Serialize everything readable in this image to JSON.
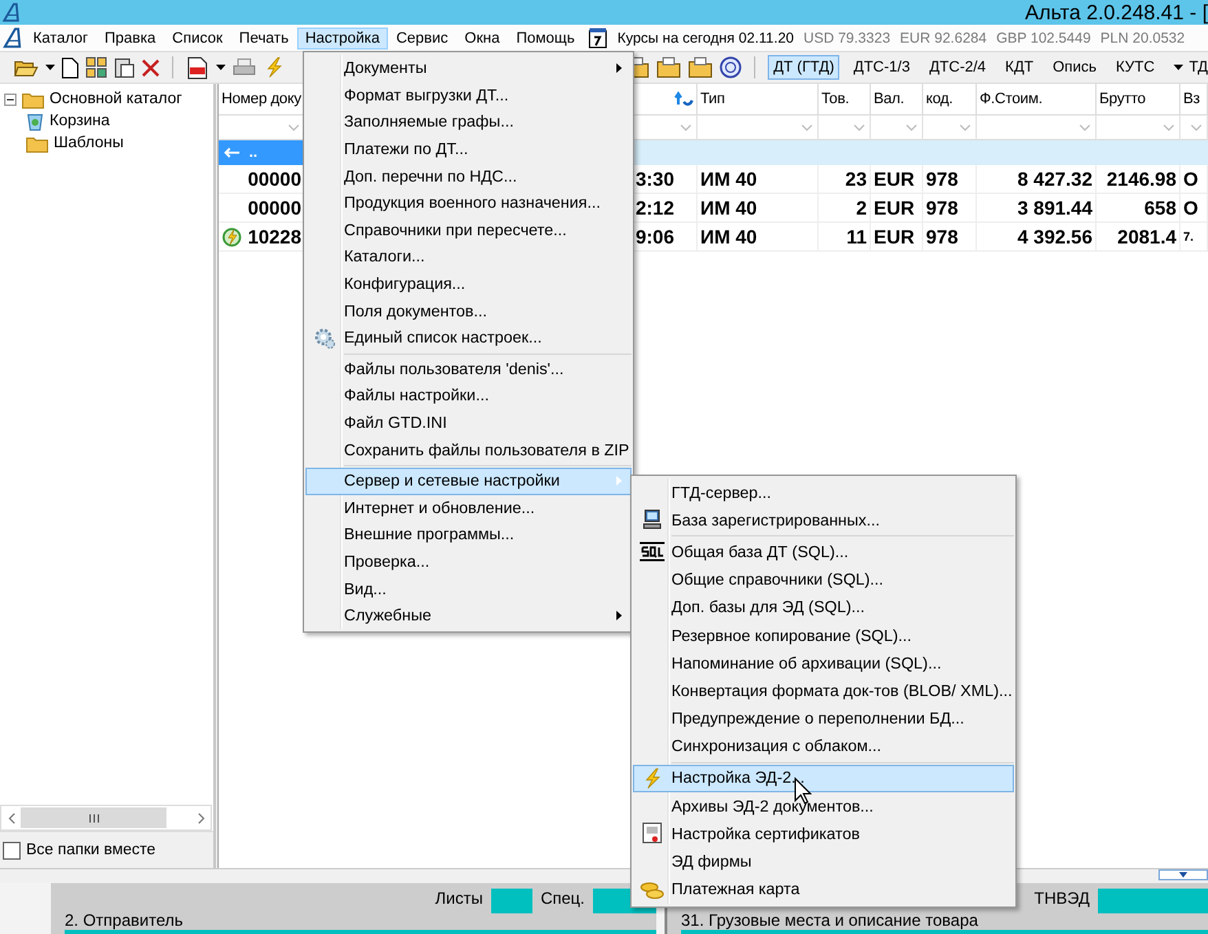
{
  "window": {
    "title": "Альта 2.0.248.41 - ["
  },
  "menu_bar": {
    "items": [
      {
        "label": "Каталог",
        "selected": false
      },
      {
        "label": "Правка",
        "selected": false
      },
      {
        "label": "Список",
        "selected": false
      },
      {
        "label": "Печать",
        "selected": false
      },
      {
        "label": "Настройка",
        "selected": true
      },
      {
        "label": "Сервис",
        "selected": false
      },
      {
        "label": "Окна",
        "selected": false
      },
      {
        "label": "Помощь",
        "selected": false
      }
    ]
  },
  "rates": {
    "label": "Курсы на сегодня 02.11.20",
    "values": [
      "USD 79.3323",
      "EUR 92.6284",
      "GBP 102.5449",
      "PLN 20.0532"
    ]
  },
  "toolbar": {
    "doc_buttons": [
      {
        "label": "ДТ (ГТД)",
        "selected": true
      },
      {
        "label": "ДТС-1/3",
        "selected": false
      },
      {
        "label": "ДТС-2/4",
        "selected": false
      },
      {
        "label": "КДТ",
        "selected": false
      },
      {
        "label": "Опись",
        "selected": false
      },
      {
        "label": "КУТС",
        "selected": false
      }
    ],
    "dropdown": "ТД"
  },
  "sidebar": {
    "tree": [
      {
        "label": "Основной каталог",
        "kind": "folder",
        "expanded": true,
        "children": [
          {
            "label": "Корзина",
            "kind": "trash"
          },
          {
            "label": "Шаблоны",
            "kind": "folder"
          }
        ]
      }
    ],
    "all_folders": {
      "label": "Все папки вместе",
      "checked": false
    }
  },
  "table": {
    "columns": [
      {
        "label": "Номер доку",
        "sorted": false
      },
      {
        "sorted": true
      },
      {
        "label": "Тип",
        "sorted": false
      },
      {
        "label": "Тов.",
        "sorted": false
      },
      {
        "label": "Вал.",
        "sorted": false
      },
      {
        "label": "код.",
        "sorted": false
      },
      {
        "label": "Ф.Стоим.",
        "sorted": false
      },
      {
        "label": "Брутто",
        "sorted": false
      },
      {
        "label": "Вз",
        "sorted": false
      }
    ],
    "parent_row": {
      "label": ".."
    },
    "rows": [
      {
        "status_icon": false,
        "cells": [
          "00000",
          "3:30",
          "ИМ 40",
          "23",
          "EUR",
          "978",
          "8 427.32",
          "2146.98",
          "О"
        ]
      },
      {
        "status_icon": false,
        "cells": [
          "00000",
          "2:12",
          "ИМ 40",
          "2",
          "EUR",
          "978",
          "3 891.44",
          "658",
          "О"
        ]
      },
      {
        "status_icon": true,
        "cells": [
          "10228",
          "9:06",
          "ИМ 40",
          "11",
          "EUR",
          "978",
          "4 392.56",
          "2081.4",
          "7."
        ]
      }
    ]
  },
  "form": {
    "sender": "2. Отправитель",
    "sheets": "Листы",
    "spec": "Спец.",
    "goods": "31. Грузовые места и описание товара",
    "hs_code": "ТНВЭД"
  },
  "menu": {
    "items": [
      {
        "kind": "item",
        "label": "Документы",
        "has_submenu": true,
        "selected": false
      },
      {
        "kind": "item",
        "label": "Формат выгрузки ДТ...",
        "has_submenu": false,
        "selected": false
      },
      {
        "kind": "item",
        "label": "Заполняемые графы...",
        "has_submenu": false,
        "selected": false
      },
      {
        "kind": "item",
        "label": "Платежи по ДТ...",
        "has_submenu": false,
        "selected": false
      },
      {
        "kind": "item",
        "label": "Доп. перечни по НДС...",
        "has_submenu": false,
        "selected": false
      },
      {
        "kind": "item",
        "label": "Продукция военного назначения...",
        "has_submenu": false,
        "selected": false
      },
      {
        "kind": "item",
        "label": "Справочники при пересчете...",
        "has_submenu": false,
        "selected": false
      },
      {
        "kind": "item",
        "label": "Каталоги...",
        "has_submenu": false,
        "selected": false
      },
      {
        "kind": "item",
        "label": "Конфигурация...",
        "has_submenu": false,
        "selected": false
      },
      {
        "kind": "item",
        "label": "Поля документов...",
        "has_submenu": false,
        "selected": false
      },
      {
        "kind": "item",
        "label": "Единый список настроек...",
        "has_submenu": false,
        "selected": false
      },
      {
        "kind": "separator"
      },
      {
        "kind": "item",
        "label": "Файлы пользователя 'denis'...",
        "has_submenu": false,
        "selected": false
      },
      {
        "kind": "item",
        "label": "Файлы настройки...",
        "has_submenu": false,
        "selected": false
      },
      {
        "kind": "item",
        "label": "Файл GTD.INI",
        "has_submenu": false,
        "selected": false
      },
      {
        "kind": "item",
        "label": "Сохранить файлы пользователя в ZIP",
        "has_submenu": false,
        "selected": false
      },
      {
        "kind": "separator"
      },
      {
        "kind": "item",
        "label": "Сервер и сетевые настройки",
        "has_submenu": true,
        "selected": true
      },
      {
        "kind": "item",
        "label": "Интернет и обновление...",
        "has_submenu": false,
        "selected": false
      },
      {
        "kind": "item",
        "label": "Внешние программы...",
        "has_submenu": false,
        "selected": false
      },
      {
        "kind": "item",
        "label": "Проверка...",
        "has_submenu": false,
        "selected": false
      },
      {
        "kind": "item",
        "label": "Вид...",
        "has_submenu": false,
        "selected": false
      },
      {
        "kind": "item",
        "label": "Служебные",
        "has_submenu": true,
        "selected": false
      }
    ]
  },
  "submenu": {
    "items": [
      {
        "kind": "item",
        "label": "ГТД-сервер...",
        "has_submenu": false,
        "selected": false
      },
      {
        "kind": "item",
        "label": "База зарегистрированных...",
        "has_submenu": false,
        "selected": false
      },
      {
        "kind": "separator"
      },
      {
        "kind": "item",
        "label": "Общая база ДТ (SQL)...",
        "has_submenu": false,
        "selected": false
      },
      {
        "kind": "item",
        "label": "Общие справочники (SQL)...",
        "has_submenu": false,
        "selected": false
      },
      {
        "kind": "item",
        "label": "Доп. базы для ЭД (SQL)...",
        "has_submenu": false,
        "selected": false
      },
      {
        "kind": "item",
        "label": "Резервное копирование (SQL)...",
        "has_submenu": false,
        "selected": false
      },
      {
        "kind": "item",
        "label": "Напоминание об архивации (SQL)...",
        "has_submenu": false,
        "selected": false
      },
      {
        "kind": "item",
        "label": "Конвертация формата док-тов (BLOB/ XML)...",
        "has_submenu": false,
        "selected": false
      },
      {
        "kind": "item",
        "label": "Предупреждение о переполнении БД...",
        "has_submenu": false,
        "selected": false
      },
      {
        "kind": "item",
        "label": "Синхронизация с облаком...",
        "has_submenu": false,
        "selected": false
      },
      {
        "kind": "separator"
      },
      {
        "kind": "item",
        "label": "Настройка ЭД-2...",
        "has_submenu": false,
        "selected": true
      },
      {
        "kind": "item",
        "label": "Архивы ЭД-2 документов...",
        "has_submenu": false,
        "selected": false
      },
      {
        "kind": "item",
        "label": "Настройка сертификатов",
        "has_submenu": false,
        "selected": false
      },
      {
        "kind": "item",
        "label": "ЭД фирмы",
        "has_submenu": false,
        "selected": false
      },
      {
        "kind": "item",
        "label": "Платежная карта",
        "has_submenu": false,
        "selected": false
      }
    ]
  }
}
